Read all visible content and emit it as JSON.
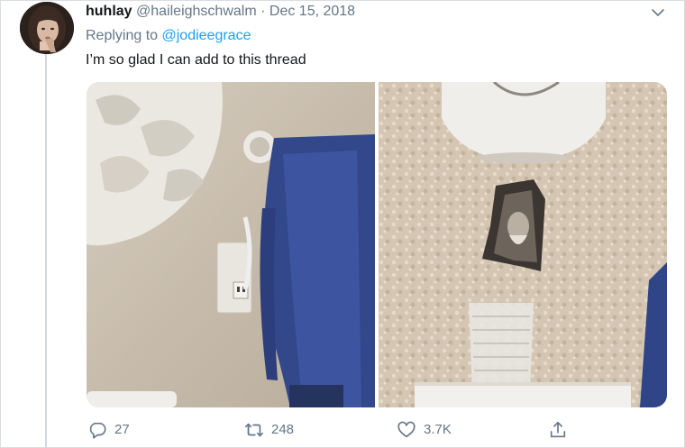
{
  "tweet": {
    "display_name": "huhlay",
    "handle": "@haileighschwalm",
    "separator": "·",
    "date": "Dec 15, 2018",
    "replying_prefix": "Replying to",
    "replying_handle": "@jodieegrace",
    "text": "I’m so glad I can add to this thread"
  },
  "actions": {
    "reply_count": "27",
    "retweet_count": "248",
    "like_count": "3.7K"
  },
  "icons": {
    "reply": "reply-icon",
    "retweet": "retweet-icon",
    "like": "heart-icon",
    "share": "share-icon",
    "more": "chevron-down-icon"
  },
  "colors": {
    "link": "#1da1f2",
    "secondary_text": "#657786",
    "primary_text": "#14171a"
  }
}
